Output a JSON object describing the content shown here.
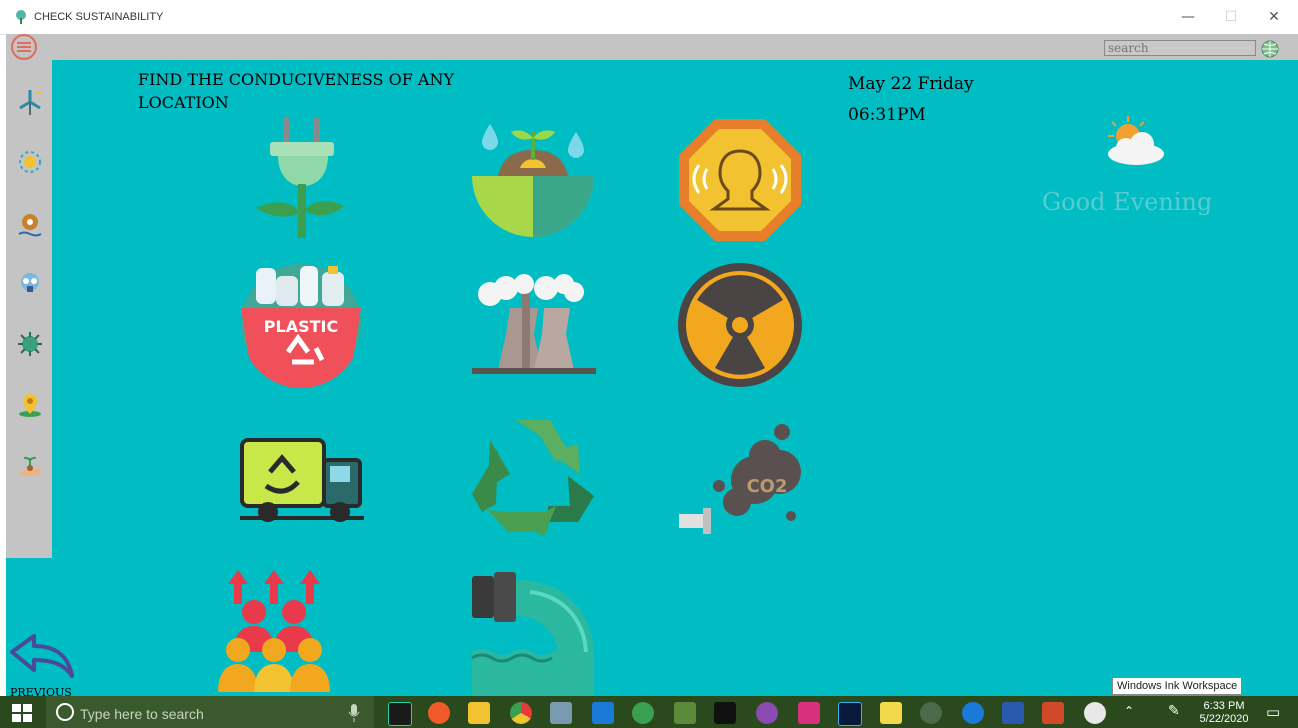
{
  "window": {
    "title": "CHECK SUSTAINABILITY",
    "minimize": "—",
    "maximize": "☐",
    "close": "✕"
  },
  "search": {
    "placeholder": "search"
  },
  "main": {
    "heading": "FIND THE CONDUCIVENESS OF ANY LOCATION",
    "date": "May 22 Friday",
    "time": "06:31PM",
    "greeting": "Good Evening",
    "previous_label": "PREVIOUS"
  },
  "tiles": [
    {
      "name": "energy-plug-plant",
      "icon": "plug-plant-icon"
    },
    {
      "name": "soil-water",
      "icon": "earth-sprout-icon"
    },
    {
      "name": "noise",
      "icon": "noise-head-icon"
    },
    {
      "name": "plastic",
      "icon": "plastic-recycle-icon",
      "label": "PLASTIC"
    },
    {
      "name": "factory-emissions",
      "icon": "factory-icon"
    },
    {
      "name": "radiation",
      "icon": "radiation-icon"
    },
    {
      "name": "waste-truck",
      "icon": "recycle-truck-icon"
    },
    {
      "name": "recycling",
      "icon": "recycle-arrows-icon"
    },
    {
      "name": "co2",
      "icon": "co2-exhaust-icon",
      "label": "CO2"
    },
    {
      "name": "population",
      "icon": "population-growth-icon"
    },
    {
      "name": "sewage",
      "icon": "pipe-discharge-icon"
    }
  ],
  "taskbar": {
    "search_text": "Type here to search",
    "clock_time": "6:33 PM",
    "clock_date": "5/22/2020",
    "tooltip": "Windows Ink Workspace"
  }
}
